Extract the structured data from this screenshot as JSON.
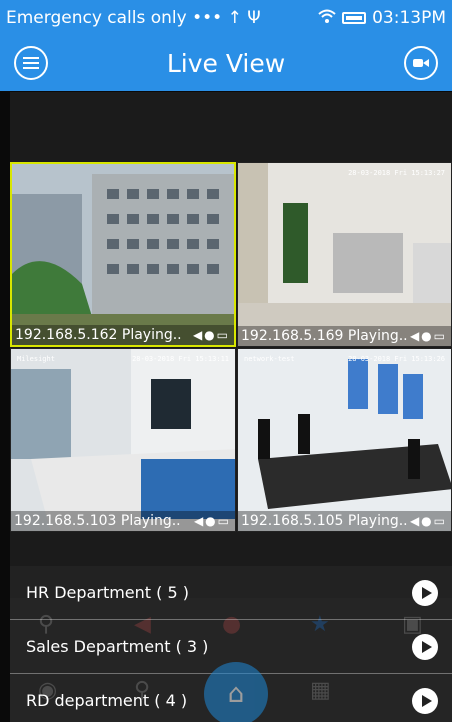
{
  "status_bar": {
    "left_text": "Emergency calls only ••• ↑ Ψ",
    "time": "03:13PM",
    "signal_icon": "wifi-icon"
  },
  "app_bar": {
    "title": "Live View",
    "menu_icon": "menu-icon",
    "record_icon": "record-icon"
  },
  "cameras": [
    {
      "label": "192.168.5.162 Playing..",
      "selected": true,
      "timestamp": "",
      "osd": ""
    },
    {
      "label": "192.168.5.169 Playing..",
      "selected": false,
      "timestamp": "28-03-2018 Fri 15:13:27",
      "osd": ""
    },
    {
      "label": "192.168.5.103 Playing..",
      "selected": false,
      "timestamp": "28-03-2018 Fri 15:13:11",
      "osd": "Milesight"
    },
    {
      "label": "192.168.5.105 Playing..",
      "selected": false,
      "timestamp": "28-03-2018 Fri 15:13:26",
      "osd": "network-test"
    }
  ],
  "departments": [
    {
      "label": "HR Department ( 5 )"
    },
    {
      "label": "Sales Department ( 3 )"
    },
    {
      "label": "RD department ( 4 )"
    }
  ],
  "colors": {
    "accent": "#2a8fe6",
    "selection": "#d8e600"
  }
}
